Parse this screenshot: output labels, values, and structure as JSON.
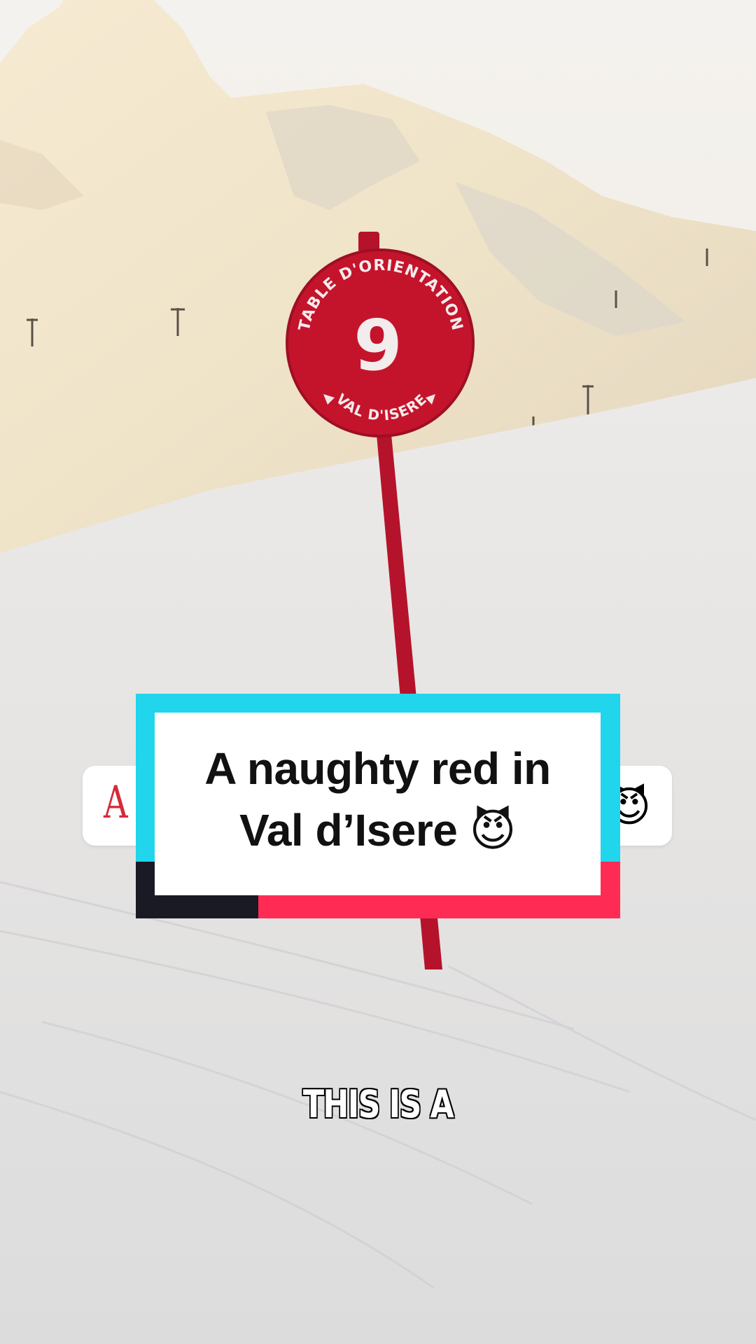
{
  "sign": {
    "top_text": "TABLE D'ORIENTATION",
    "number": "9",
    "bottom_text": "VAL D'ISERE"
  },
  "back_caption": {
    "visible_letter": "A",
    "visible_emoji": "😈"
  },
  "title_card": {
    "line1": "A naughty red in",
    "line2": "Val d’Isere 😈"
  },
  "subtitle": "THIS IS A",
  "colors": {
    "card_cyan": "#20d5ec",
    "card_pink": "#fe2c55",
    "card_dark": "#1a1a24",
    "sign_red": "#c4142c"
  }
}
